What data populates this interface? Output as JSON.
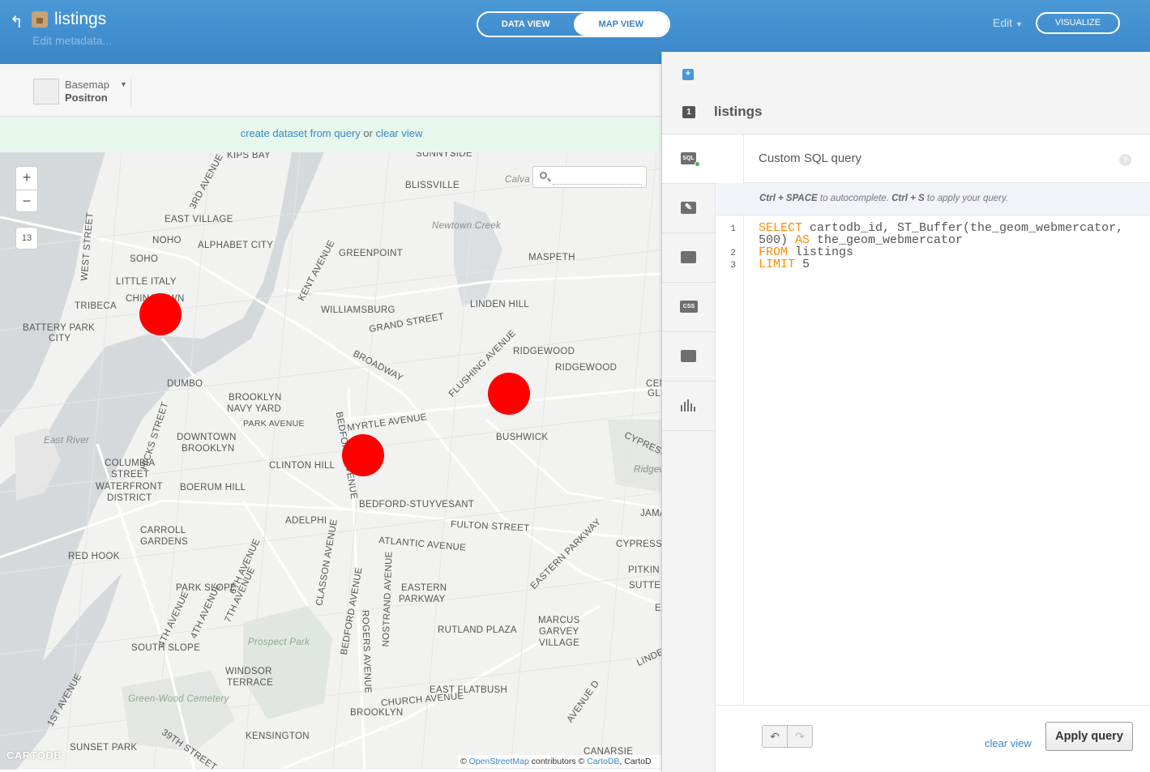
{
  "header": {
    "title": "listings",
    "edit_metadata": "Edit metadata...",
    "tabs": [
      {
        "label": "DATA VIEW",
        "active": false
      },
      {
        "label": "MAP VIEW",
        "active": true
      }
    ],
    "edit_menu": "Edit",
    "visualize": "VISUALIZE",
    "accent": "#3a86c8"
  },
  "toolbar": {
    "basemap_label": "Basemap",
    "basemap_value": "Positron"
  },
  "notice": {
    "create_link": "create dataset from query",
    "or": "or",
    "clear_link": "clear view"
  },
  "map": {
    "zoom_in": "+",
    "zoom_out": "−",
    "zoom_level": "13",
    "labels": [
      "KIPS BAY",
      "SUNNYSIDE",
      "3RD AVENUE",
      "BLISSVILLE",
      "EAST VILLAGE",
      "WEST STREET",
      "NOHO",
      "ALPHABET CITY",
      "Newtown Creek",
      "SOHO",
      "GREENPOINT",
      "KENT AVENUE",
      "MASPETH",
      "LITTLE ITALY",
      "CHINATOWN",
      "TRIBECA",
      "WILLIAMSBURG",
      "LINDEN HILL",
      "BATTERY PARK",
      "CITY",
      "GRAND STREET",
      "RIDGEWOOD",
      "BROADWAY",
      "FLUSHING AVENUE",
      "RIDGEWOOD",
      "DUMBO",
      "BROOKLYN",
      "NAVY YARD",
      "PARK AVENUE",
      "MYRTLE AVENUE",
      "East River",
      "HICKS STREET",
      "DOWNTOWN",
      "BROOKLYN",
      "BUSHWICK",
      "CYPRESS",
      "COLUMBIA",
      "STREET",
      "WATERFRONT",
      "DISTRICT",
      "CLINTON HILL",
      "BEDFORD AVENUE",
      "BOERUM HILL",
      "BEDFORD-STUYVESANT",
      "ADELPHI",
      "FULTON STREET",
      "CARROLL",
      "GARDENS",
      "ATLANTIC AVENUE",
      "CYPRESS",
      "RED HOOK",
      "EASTERN PARKWAY",
      "CLASSON AVENUE",
      "PARK SLOPE",
      "EASTERN",
      "PARKWAY",
      "6TH AVENUE",
      "7TH AVENUE",
      "4TH AVENUE",
      "BEDFORD AVENUE",
      "NOSTRAND AVENUE",
      "ROGERS AVENUE",
      "RUTLAND PLAZA",
      "MARCUS",
      "GARVEY",
      "VILLAGE",
      "Prospect Park",
      "SOUTH SLOPE",
      "WINDSOR",
      "TERRACE",
      "EAST FLATBUSH",
      "CHURCH AVENUE",
      "Green-Wood Cemetery",
      "1ST AVENUE",
      "BROOKLYN",
      "AVENUE D",
      "KENSINGTON",
      "SUNSET PARK",
      "39TH STREET",
      "CANARSIE",
      "Calva",
      "PITKIN",
      "SUTTER",
      "JAMA",
      "Ridgew",
      "CEN",
      "GL",
      "LINDE",
      "E",
      "4TH AVENUE"
    ],
    "points_color": "#ff0000",
    "logo": "CARTODB",
    "attribution_prefix": "©",
    "attribution_osm": "OpenStreetMap",
    "attribution_mid": "contributors ©",
    "attribution_cartodb": "CartoDB",
    "attribution_suffix": ", CartoD"
  },
  "panel": {
    "add_layer": "+",
    "layer_number": "1",
    "layer_name": "listings",
    "tabs": [
      "SQL",
      "wizard",
      "infowindow",
      "CSS",
      "legends",
      "filters"
    ],
    "sql_title": "Custom SQL query",
    "help": "?",
    "hint_key1": "Ctrl + SPACE",
    "hint_text1": "to autocomplete.",
    "hint_key2": "Ctrl + S",
    "hint_text2": "to apply your query.",
    "hint_close": "×",
    "line_numbers": [
      "1",
      "2",
      "3"
    ],
    "code": {
      "l1_kw": "SELECT",
      "l1_rest": " cartodb_id, ST_Buffer(the_geom_webmercator,",
      "l1b_a": "500) ",
      "l1b_kw": "AS",
      "l1b_rest": " the_geom_webmercator",
      "l2_kw": "FROM",
      "l2_rest": " listings",
      "l3_kw": "LIMIT",
      "l3_rest": " 5"
    },
    "undo": "↶",
    "redo": "↷",
    "clear_view": "clear view",
    "apply": "Apply query"
  }
}
